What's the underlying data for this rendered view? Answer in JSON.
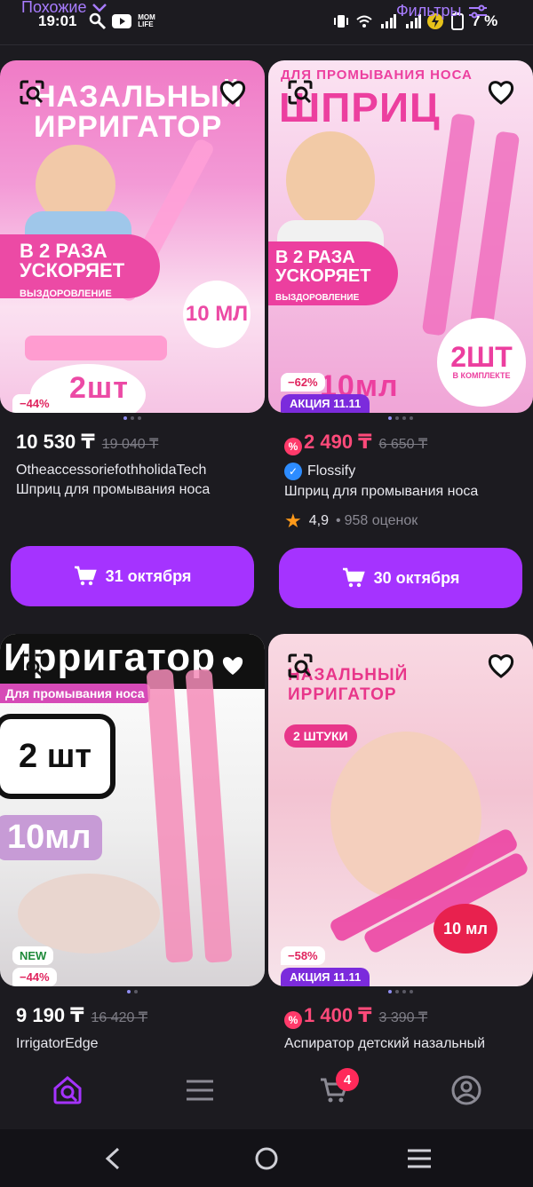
{
  "status_bar": {
    "time": "19:01",
    "battery_percent": "7 %",
    "similar_label": "Похожие",
    "filters_label": "Фильтры"
  },
  "products": [
    {
      "image_headline": "НАЗАЛЬНЫЙ ИРРИГАТОР",
      "image_badge_1": "В 2 РАЗА УСКОРЯЕТ",
      "image_badge_2": "ВЫЗДОРОВЛЕНИЕ",
      "image_volume": "10 МЛ",
      "image_count": "2шт",
      "discount": "−44%",
      "promo": "",
      "price": "10 530 ₸",
      "old_price": "19 040 ₸",
      "seller": "OtheaccessoriefothholidaTech",
      "title": "Шприц для промывания носа",
      "delivery": "31 октября"
    },
    {
      "image_headline_top": "ДЛЯ ПРОМЫВАНИЯ НОСА",
      "image_headline": "ШПРИЦ",
      "image_badge_1": "В 2 РАЗА УСКОРЯЕТ",
      "image_badge_2": "ВЫЗДОРОВЛЕНИЕ",
      "image_count": "2ШТ",
      "image_count_sub": "В КОМПЛЕКТЕ",
      "image_volume": "10мл",
      "discount": "−62%",
      "promo": "АКЦИЯ 11.11",
      "price": "2 490 ₸",
      "old_price": "6 650 ₸",
      "seller": "Flossify",
      "title": "Шприц для промывания носа",
      "rating": "4,9",
      "reviews": "958 оценок",
      "delivery": "30 октября"
    },
    {
      "image_headline": "Ирригатор",
      "image_badge_1": "Для промывания носа",
      "image_count": "2 шт",
      "image_volume": "10мл",
      "new_label": "NEW",
      "discount": "−44%",
      "price": "9 190 ₸",
      "old_price": "16 420 ₸",
      "seller": "IrrigatorEdge"
    },
    {
      "image_headline": "НАЗАЛЬНЫЙ ИРРИГАТОР",
      "image_count": "2 ШТУКИ",
      "image_volume": "10 мл",
      "discount": "−58%",
      "promo": "АКЦИЯ 11.11",
      "price": "1 400 ₸",
      "old_price": "3 390 ₸",
      "title": "Аспиратор детский назальный"
    }
  ],
  "bottom_nav": {
    "cart_count": "4"
  },
  "colors": {
    "accent": "#a533ff",
    "sale": "#ff4a7a",
    "background": "#1c1b20"
  }
}
